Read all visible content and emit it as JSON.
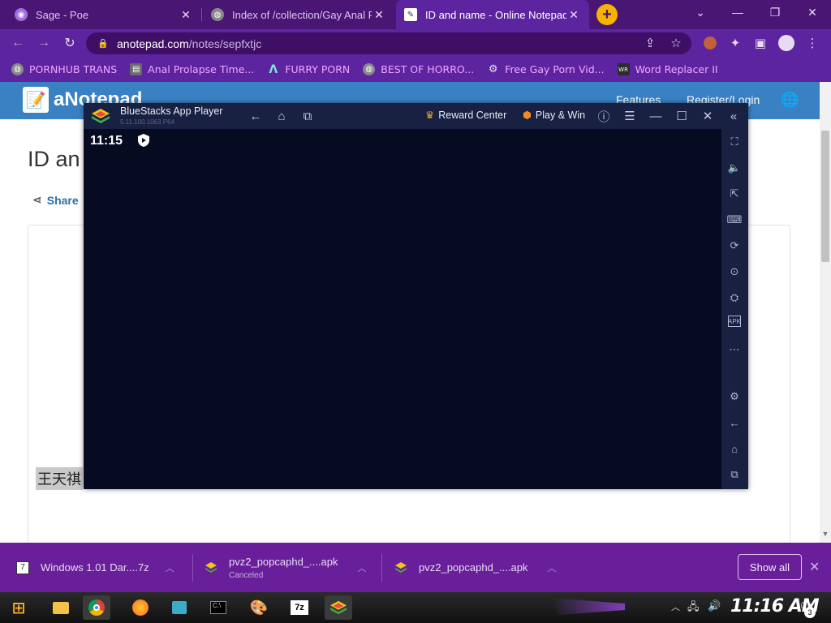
{
  "browser": {
    "tabs": [
      {
        "title": "Sage - Poe",
        "active": false
      },
      {
        "title": "Index of /collection/Gay Anal Pr",
        "active": false
      },
      {
        "title": "ID and name - Online Notepad",
        "active": true
      }
    ],
    "new_tab_glyph": "+",
    "window_controls": {
      "dropdown": "⌄",
      "minimize": "—",
      "restore": "❐",
      "close": "✕"
    },
    "address": {
      "host": "anotepad.com",
      "path": "/notes/sepfxtjc"
    },
    "bookmarks": [
      {
        "label": "PORNHUB TRANS",
        "icon": "globe-icon"
      },
      {
        "label": "Anal Prolapse Time...",
        "icon": "page-icon"
      },
      {
        "label": "FURRY PORN",
        "icon": "arc-icon"
      },
      {
        "label": "BEST OF HORRO...",
        "icon": "globe-icon"
      },
      {
        "label": "Free Gay Porn Vid...",
        "icon": "robot-icon"
      },
      {
        "label": "Word Replacer II",
        "icon": "wr-icon"
      }
    ]
  },
  "site": {
    "logo": "aNotepad",
    "nav": [
      "Features",
      "Register/Login"
    ],
    "title": "ID an",
    "share_label": "Share",
    "note_text": "王天祺"
  },
  "bluestacks": {
    "app_name": "BlueStacks App Player",
    "version": "5.11.100.1063 P64",
    "reward_center": "Reward Center",
    "play_win": "Play & Win",
    "clock": "11:15"
  },
  "downloads": {
    "items": [
      {
        "name": "Windows 1.01 Dar....7z",
        "status": ""
      },
      {
        "name": "pvz2_popcaphd_....apk",
        "status": "Canceled"
      },
      {
        "name": "pvz2_popcaphd_....apk",
        "status": ""
      }
    ],
    "show_all": "Show all"
  },
  "taskbar": {
    "clock": "11:16 AM",
    "notification_count": "3"
  },
  "colors": {
    "browser_frame": "#5d24a0",
    "site_header": "#3a81c4",
    "bluestacks_frame": "#182142",
    "download_bar": "#6a1f9a"
  }
}
